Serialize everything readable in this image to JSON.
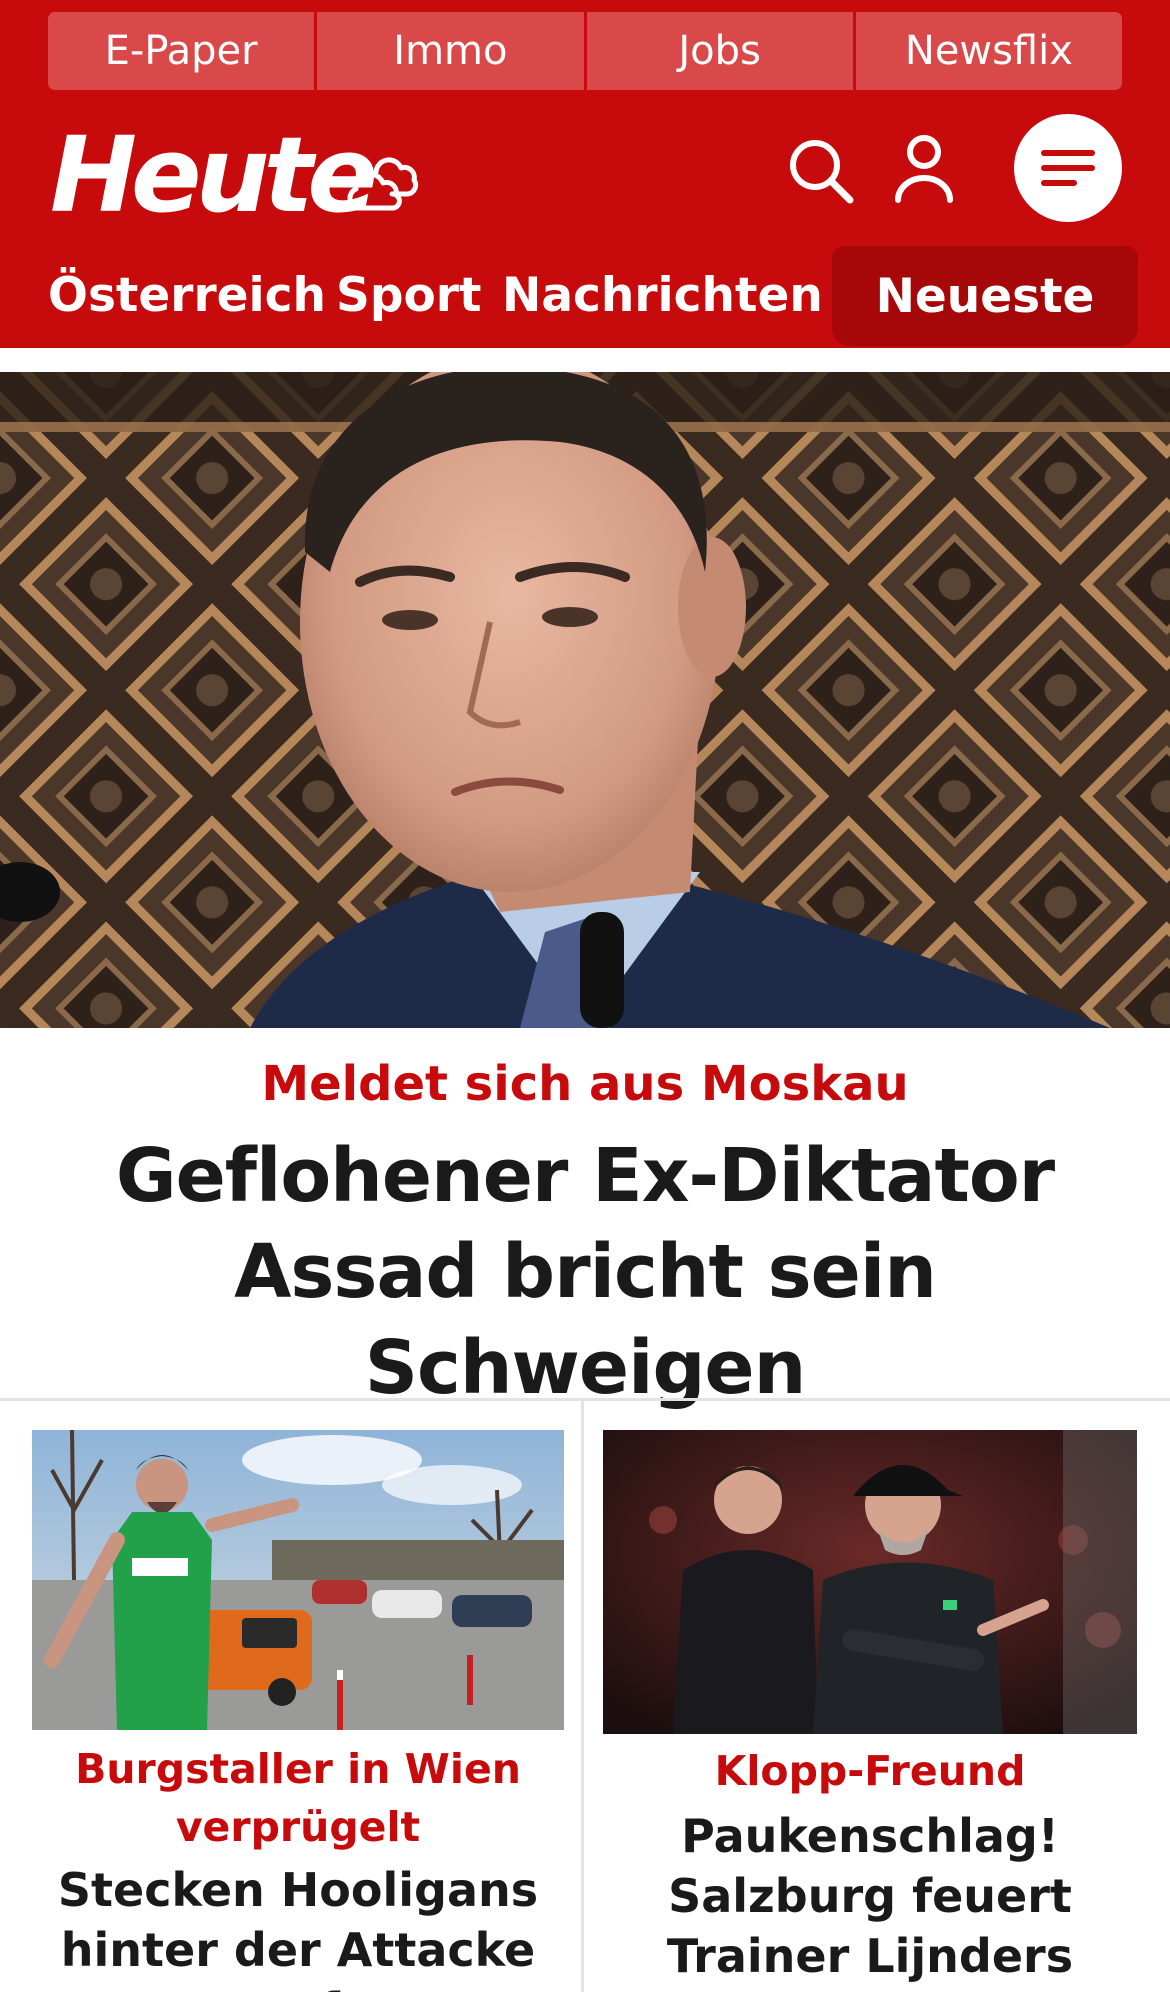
{
  "header": {
    "top_links": [
      "E-Paper",
      "Immo",
      "Jobs",
      "Newsflix"
    ],
    "logo": "Heute",
    "icons": {
      "weather": "weather-cloud-icon",
      "search": "search-icon",
      "user": "user-icon",
      "menu": "menu-icon"
    },
    "nav": {
      "items": [
        "Österreich",
        "Sport",
        "Nachrichten"
      ],
      "highlight": "Neueste"
    }
  },
  "hero": {
    "kicker": "Meldet sich aus Moskau",
    "title": "Geflohener Ex-Diktator Assad bricht sein Schweigen"
  },
  "cards": [
    {
      "kicker": "Burgstaller in Wien verprügelt",
      "title": "Stecken Hooligans hinter der Attacke auf"
    },
    {
      "kicker": "Klopp-Freund",
      "title": "Paukenschlag! Salzburg feuert Trainer Lijnders"
    }
  ],
  "colors": {
    "brand_red": "#c70a0c",
    "dark_red": "#a6080a",
    "link_red": "#d9494a",
    "text": "#1a1a1a",
    "divider": "#e3e3e3"
  }
}
